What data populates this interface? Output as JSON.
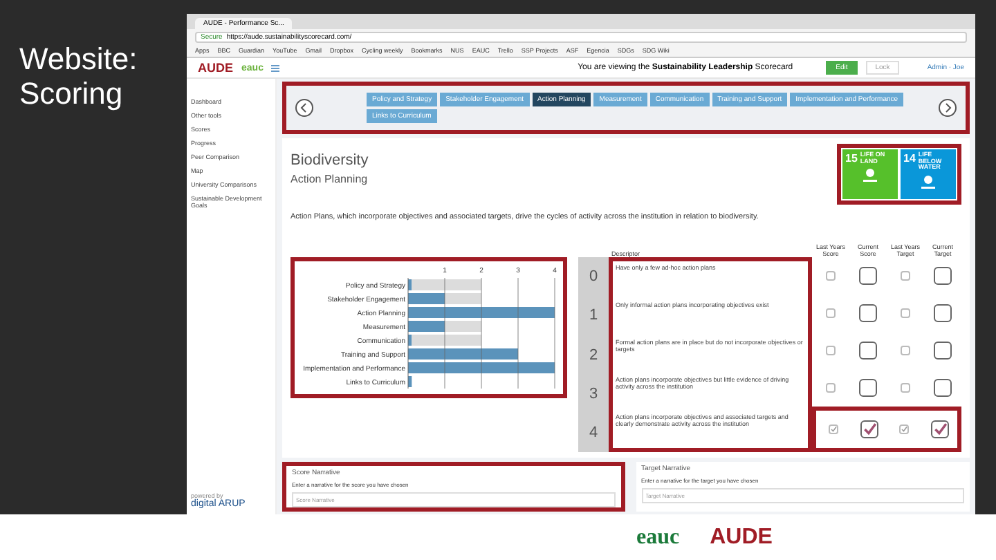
{
  "slide_title": "Website: Scoring",
  "browser": {
    "tab_title": "AUDE - Performance Sc...",
    "address_secure": "Secure",
    "address": "https://aude.sustainabilityscorecard.com/",
    "bookmarks": [
      "Apps",
      "BBC",
      "Guardian",
      "YouTube",
      "Gmail",
      "Dropbox",
      "Cycling weekly",
      "Bookmarks",
      "NUS",
      "EAUC",
      "Trello",
      "SSP Projects",
      "ASF",
      "Egencia",
      "SDGs",
      "SDG Wiki"
    ]
  },
  "header": {
    "viewing_text": "You are viewing the **Sustainability Leadership** Scorecard",
    "buttons": [
      {
        "label": "Edit",
        "kind": "primary"
      },
      {
        "label": "Lock",
        "kind": "plain"
      }
    ],
    "user": "Admin · Joe"
  },
  "sidebar": {
    "items": [
      "Dashboard",
      "Other tools",
      "Scores",
      "Progress",
      "Peer Comparison",
      "Map",
      "University Comparisons",
      "Sustainable Development Goals"
    ],
    "footer_small": "powered by",
    "footer_brand": "digital ARUP"
  },
  "nav": {
    "tabs": [
      {
        "label": "Policy and Strategy",
        "selected": false
      },
      {
        "label": "Stakeholder Engagement",
        "selected": false
      },
      {
        "label": "Action Planning",
        "selected": true
      },
      {
        "label": "Measurement",
        "selected": false
      },
      {
        "label": "Communication",
        "selected": false
      },
      {
        "label": "Training and Support",
        "selected": false
      },
      {
        "label": "Implementation and Performance",
        "selected": false
      },
      {
        "label": "Links to Curriculum",
        "selected": false
      }
    ]
  },
  "section": {
    "title": "Biodiversity",
    "subtitle": "Action Planning",
    "sdg_tiles": [
      {
        "number": "15",
        "label": "LIFE ON LAND",
        "color": "#56c02b"
      },
      {
        "number": "14",
        "label": "LIFE BELOW WATER",
        "color": "#0a97d9"
      }
    ],
    "statement": "Action Plans, which incorporate objectives and associated targets, drive the cycles of activity across the institution in relation to biodiversity."
  },
  "chart_data": {
    "type": "bar",
    "orientation": "horizontal",
    "categories": [
      "Policy and Strategy",
      "Stakeholder Engagement",
      "Action Planning",
      "Measurement",
      "Communication",
      "Training and Support",
      "Implementation and Performance",
      "Links to Curriculum"
    ],
    "series": [
      {
        "color": "#5b93bb",
        "values": [
          0.1,
          1,
          4,
          1,
          0.1,
          3,
          4,
          0.1
        ]
      },
      {
        "color": "#dcdcdc",
        "values": [
          1.9,
          1,
          0,
          1,
          1.9,
          0,
          0,
          0
        ]
      }
    ],
    "stacked": true,
    "grid": true,
    "xlim": [
      0,
      4
    ],
    "xticks": [
      1,
      2,
      3,
      4
    ]
  },
  "table": {
    "columns": [
      "Descriptor",
      "Last Years Score",
      "Current Score",
      "Last Years Target",
      "Current Target"
    ],
    "rows": [
      {
        "score": "0",
        "descriptor": "Have only a few ad-hoc action plans",
        "last_score": false,
        "current_score": false,
        "last_target": false,
        "current_target": false
      },
      {
        "score": "1",
        "descriptor": "Only informal action plans incorporating objectives exist",
        "last_score": false,
        "current_score": false,
        "last_target": false,
        "current_target": false
      },
      {
        "score": "2",
        "descriptor": "Formal action plans are in place but do not incorporate objectives or targets",
        "last_score": false,
        "current_score": false,
        "last_target": false,
        "current_target": false
      },
      {
        "score": "3",
        "descriptor": "Action plans incorporate objectives but little evidence of driving activity across the institution",
        "last_score": false,
        "current_score": false,
        "last_target": false,
        "current_target": false
      },
      {
        "score": "4",
        "descriptor": "Action plans incorporate objectives and associated targets and clearly demonstrate activity across the institution",
        "last_score": true,
        "current_score": true,
        "last_target": true,
        "current_target": true
      }
    ]
  },
  "narratives": [
    {
      "title": "Score Narrative",
      "hint": "Enter a narrative for the score you have chosen",
      "placeholder": "Score Narrative"
    },
    {
      "title": "Target Narrative",
      "hint": "Enter a narrative for the target you have chosen",
      "placeholder": "Target Narrative"
    }
  ],
  "header_logos": {
    "eauc": "eauc",
    "aude": "AUDE"
  },
  "footer_logos": {
    "eauc": "eauc",
    "aude": "AUDE"
  }
}
